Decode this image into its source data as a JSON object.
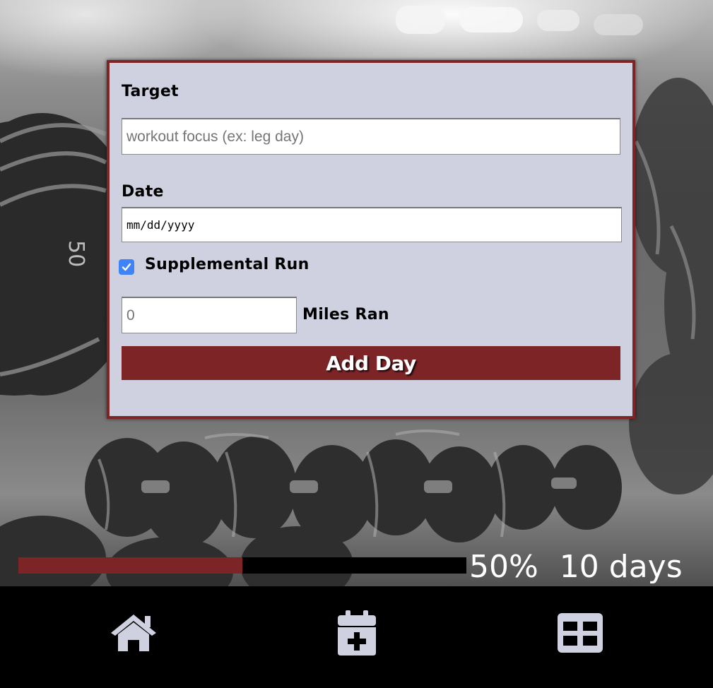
{
  "form": {
    "target_label": "Target",
    "target_placeholder": "workout focus (ex: leg day)",
    "target_value": "",
    "date_label": "Date",
    "date_value": "mm/dd/yyyy",
    "supplemental_label": "Supplemental Run",
    "supplemental_checked": true,
    "miles_value": "0",
    "miles_label": "Miles Ran",
    "submit_label": "Add Day"
  },
  "progress": {
    "percent_value": 0.5,
    "percent_text": "50%",
    "days_text": "10 days"
  },
  "nav": {
    "items": [
      {
        "icon": "home-icon",
        "name": "home"
      },
      {
        "icon": "calendar-plus-icon",
        "name": "add-day"
      },
      {
        "icon": "table-grid-icon",
        "name": "table"
      }
    ]
  },
  "colors": {
    "accent": "#7d2427",
    "card_background": "#cfd0e0",
    "nav_background": "#000000",
    "nav_icon": "#cfd0e0",
    "checkbox": "#3f83f6"
  }
}
